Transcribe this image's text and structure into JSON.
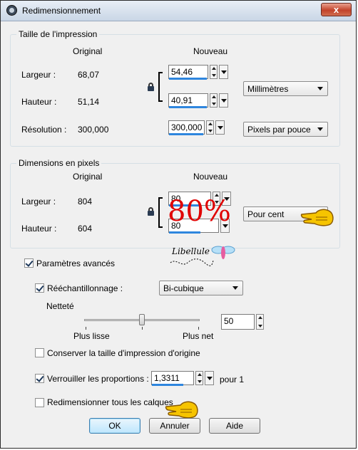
{
  "window": {
    "title": "Redimensionnement",
    "close_glyph": "x"
  },
  "print_size": {
    "title": "Taille de l'impression",
    "col_original": "Original",
    "col_new": "Nouveau",
    "width": {
      "label": "Largeur :",
      "original": "68,07",
      "value": "54,46"
    },
    "height": {
      "label": "Hauteur :",
      "original": "51,14",
      "value": "40,91"
    },
    "resolution": {
      "label": "Résolution :",
      "original": "300,000",
      "value": "300,000"
    },
    "unit_select": "Millimètres",
    "resolution_unit_select": "Pixels par pouce"
  },
  "pixel_dims": {
    "title": "Dimensions en pixels",
    "col_original": "Original",
    "col_new": "Nouveau",
    "width": {
      "label": "Largeur :",
      "original": "804",
      "value": "80"
    },
    "height": {
      "label": "Hauteur :",
      "original": "604",
      "value": "80"
    },
    "unit_select": "Pour cent",
    "overlay_text": "80%"
  },
  "advanced": {
    "label": "Paramètres avancés",
    "checked": true
  },
  "resample": {
    "label": "Rééchantillonnage :",
    "checked": true,
    "method": "Bi-cubique"
  },
  "sharpness": {
    "label": "Netteté",
    "value": "50",
    "min_label": "Plus lisse",
    "max_label": "Plus net"
  },
  "keep_print_size": {
    "label": "Conserver la taille d'impression d'origine",
    "checked": false
  },
  "lock_ratio": {
    "label": "Verrouiller les proportions :",
    "checked": true,
    "value": "1,3311",
    "suffix": "pour 1"
  },
  "resize_all_layers": {
    "label": "Redimensionner tous les calques",
    "checked": false
  },
  "buttons": {
    "ok": "OK",
    "cancel": "Annuler",
    "help": "Aide"
  },
  "signature": {
    "text": "Libellule"
  },
  "icons": [
    "app-icon",
    "lock-icon",
    "pointing-hand-icon",
    "dragonfly-icon"
  ]
}
